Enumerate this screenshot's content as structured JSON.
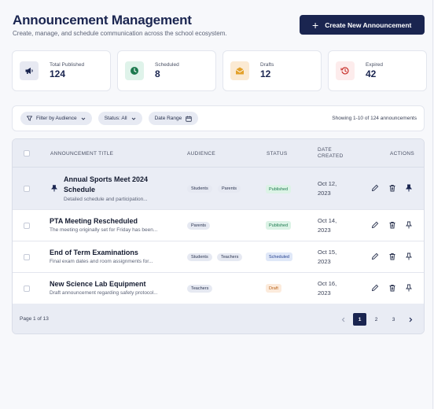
{
  "header": {
    "title": "Announcement Management",
    "subtitle": "Create, manage, and schedule communication across the school ecosystem.",
    "create_button": "Create New Announcement"
  },
  "stats": [
    {
      "label": "Total Published",
      "value": "124",
      "icon": "megaphone-icon",
      "color": "#1a2550"
    },
    {
      "label": "Scheduled",
      "value": "8",
      "icon": "clock-icon",
      "color": "#1d7a4f"
    },
    {
      "label": "Drafts",
      "value": "12",
      "icon": "envelope-icon",
      "color": "#e3a12b"
    },
    {
      "label": "Expired",
      "value": "42",
      "icon": "history-icon",
      "color": "#c8312b"
    }
  ],
  "filters": {
    "audience": "Filter by Audience",
    "status": "Status: All",
    "date_range": "Date Range",
    "showing": "Showing 1-10 of 124 announcements"
  },
  "table": {
    "columns": [
      "ANNOUNCEMENT TITLE",
      "AUDIENCE",
      "STATUS",
      "DATE CREATED",
      "ACTIONS"
    ],
    "rows": [
      {
        "title_line1": "Annual Sports Meet 2024",
        "title_line2": "Schedule",
        "desc": "Detailed schedule and participation...",
        "audience": [
          "Students",
          "Parents"
        ],
        "status": "Published",
        "date_line1": "Oct 12,",
        "date_line2": "2023",
        "pinned": true
      },
      {
        "title_line1": "PTA Meeting Rescheduled",
        "desc": "The meeting originally set for Friday has been...",
        "audience": [
          "Parents"
        ],
        "status": "Published",
        "date_line1": "Oct 14,",
        "date_line2": "2023",
        "pinned": false
      },
      {
        "title_line1": "End of Term Examinations",
        "desc": "Final exam dates and room assignments for...",
        "audience": [
          "Students",
          "Teachers"
        ],
        "status": "Scheduled",
        "date_line1": "Oct 15,",
        "date_line2": "2023",
        "pinned": false
      },
      {
        "title_line1": "New Science Lab Equipment",
        "desc": "Draft announcement regarding safety protocol...",
        "audience": [
          "Teachers"
        ],
        "status": "Draft",
        "date_line1": "Oct 16,",
        "date_line2": "2023",
        "pinned": false
      }
    ]
  },
  "status_colors": {
    "Published": {
      "bg": "#dcf3e6",
      "fg": "#1d7a4f"
    },
    "Scheduled": {
      "bg": "#e0e8f8",
      "fg": "#24408f"
    },
    "Draft": {
      "bg": "#fcebdc",
      "fg": "#b9621a"
    }
  },
  "pagination": {
    "info": "Page 1 of 13",
    "pages": [
      "1",
      "2",
      "3"
    ],
    "current": "1"
  }
}
